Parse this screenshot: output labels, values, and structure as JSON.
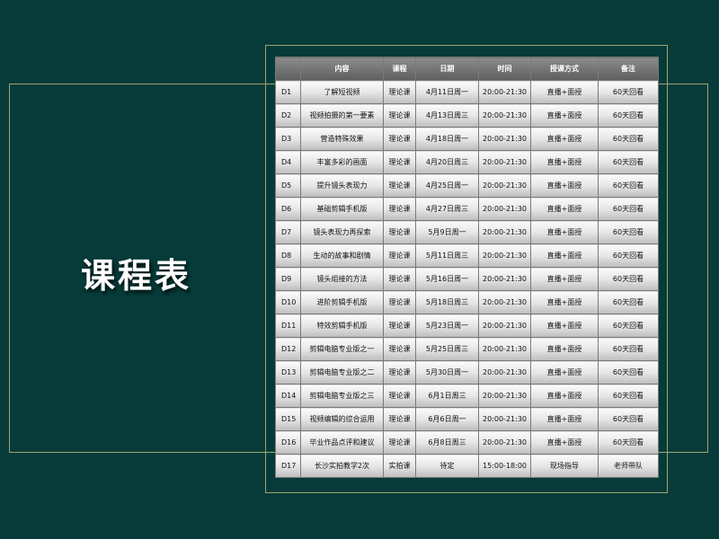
{
  "slide": {
    "title": "课程表"
  },
  "table": {
    "headers": [
      "",
      "内容",
      "课程",
      "日期",
      "时间",
      "授课方式",
      "备注"
    ],
    "rows": [
      [
        "D1",
        "了解短视频",
        "理论课",
        "4月11日周一",
        "20:00-21:30",
        "直播+面授",
        "60天回看"
      ],
      [
        "D2",
        "视频拍摄的第一要素",
        "理论课",
        "4月13日周三",
        "20:00-21:30",
        "直播+面授",
        "60天回看"
      ],
      [
        "D3",
        "营造特殊效果",
        "理论课",
        "4月18日周一",
        "20:00-21:30",
        "直播+面授",
        "60天回看"
      ],
      [
        "D4",
        "丰富多彩的画面",
        "理论课",
        "4月20日周三",
        "20:00-21:30",
        "直播+面授",
        "60天回看"
      ],
      [
        "D5",
        "提升镜头表现力",
        "理论课",
        "4月25日周一",
        "20:00-21:30",
        "直播+面授",
        "60天回看"
      ],
      [
        "D6",
        "基础剪辑手机版",
        "理论课",
        "4月27日周三",
        "20:00-21:30",
        "直播+面授",
        "60天回看"
      ],
      [
        "D7",
        "镜头表现力再探索",
        "理论课",
        "5月9日周一",
        "20:00-21:30",
        "直播+面授",
        "60天回看"
      ],
      [
        "D8",
        "生动的故事和剧情",
        "理论课",
        "5月11日周三",
        "20:00-21:30",
        "直播+面授",
        "60天回看"
      ],
      [
        "D9",
        "镜头组接的方法",
        "理论课",
        "5月16日周一",
        "20:00-21:30",
        "直播+面授",
        "60天回看"
      ],
      [
        "D10",
        "进阶剪辑手机版",
        "理论课",
        "5月18日周三",
        "20:00-21:30",
        "直播+面授",
        "60天回看"
      ],
      [
        "D11",
        "特效剪辑手机版",
        "理论课",
        "5月23日周一",
        "20:00-21:30",
        "直播+面授",
        "60天回看"
      ],
      [
        "D12",
        "剪辑电脑专业版之一",
        "理论课",
        "5月25日周三",
        "20:00-21:30",
        "直播+面授",
        "60天回看"
      ],
      [
        "D13",
        "剪辑电脑专业版之二",
        "理论课",
        "5月30日周一",
        "20:00-21:30",
        "直播+面授",
        "60天回看"
      ],
      [
        "D14",
        "剪辑电脑专业版之三",
        "理论课",
        "6月1日周三",
        "20:00-21:30",
        "直播+面授",
        "60天回看"
      ],
      [
        "D15",
        "视频编辑的综合运用",
        "理论课",
        "6月6日周一",
        "20:00-21:30",
        "直播+面授",
        "60天回看"
      ],
      [
        "D16",
        "毕业作品点评和建议",
        "理论课",
        "6月8日周三",
        "20:00-21:30",
        "直播+面授",
        "60天回看"
      ],
      [
        "D17",
        "长沙实拍教学2次",
        "实拍课",
        "待定",
        "15:00-18:00",
        "现场指导",
        "老师带队"
      ]
    ]
  },
  "colors": {
    "background": "#063b39",
    "frame_line": "#9aa672",
    "header_fill": "#6e6e6e",
    "cell_fill": "#e6e6e6"
  }
}
